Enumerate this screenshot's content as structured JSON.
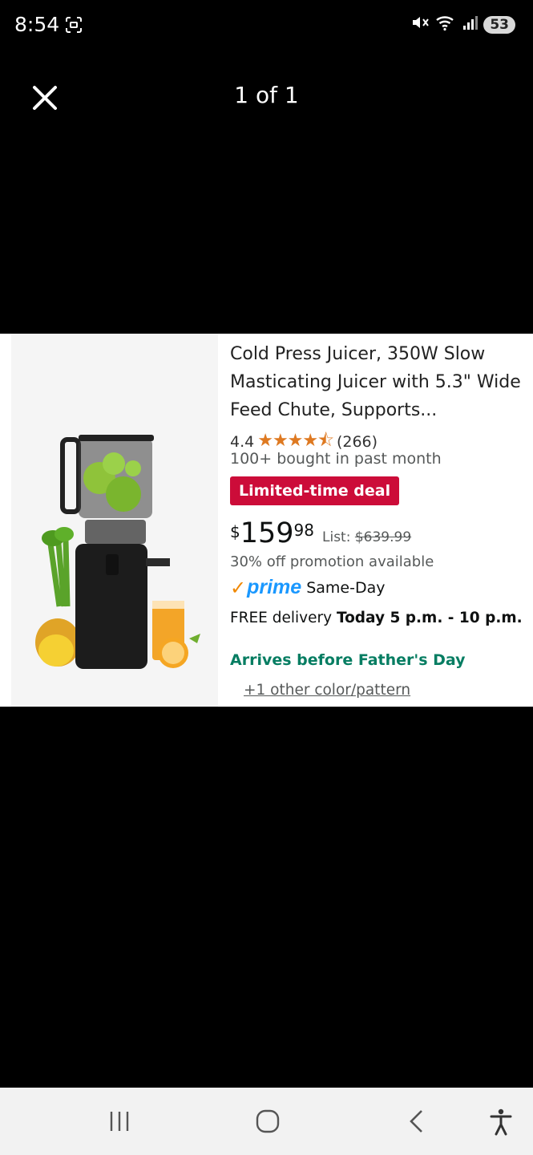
{
  "status_bar": {
    "time": "8:54",
    "battery": "53"
  },
  "viewer": {
    "counter": "1 of 1"
  },
  "product": {
    "title": "Cold Press Juicer, 350W Slow Masticating Juicer with 5.3\" Wide Feed Chute, Supports...",
    "rating": "4.4",
    "stars_filled": 4.5,
    "review_count": "(266)",
    "bought": "100+ bought in past month",
    "deal_badge": "Limited-time deal",
    "price_symbol": "$",
    "price_whole": "159",
    "price_fraction": "98",
    "list_label": "List:",
    "list_price": "$639.99",
    "promotion": "30% off promotion available",
    "prime_label": "prime",
    "prime_speed": "Same-Day",
    "delivery_prefix": "FREE delivery",
    "delivery_time": "Today 5 p.m. - 10 p.m.",
    "arrives": "Arrives before Father's Day",
    "other_colors": "+1 other color/pattern"
  },
  "colors": {
    "deal_red": "#cc0c39",
    "star_orange": "#de7921",
    "prime_blue": "#1a98ff",
    "arrives_green": "#067d62"
  }
}
